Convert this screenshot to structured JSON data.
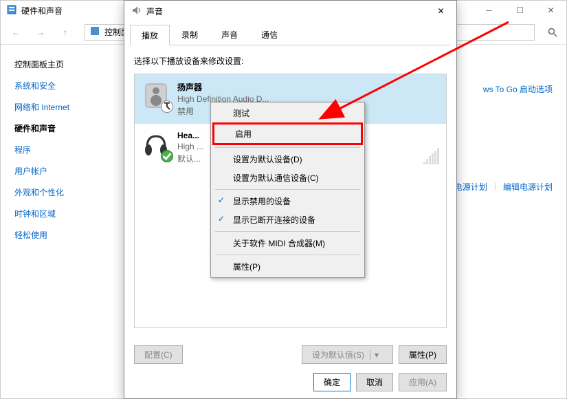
{
  "bgWindow": {
    "title": "硬件和声音",
    "address": "控制面",
    "sidebarHome": "控制面板主页",
    "sidebar": [
      "系统和安全",
      "网络和 Internet",
      "硬件和声音",
      "程序",
      "用户帐户",
      "外观和个性化",
      "时钟和区域",
      "轻松使用"
    ],
    "rightLink1": "ws To Go 启动选项",
    "rightLink2a": "电源计划",
    "rightLink2b": "编辑电源计划"
  },
  "dialog": {
    "title": "声音",
    "tabs": [
      "播放",
      "录制",
      "声音",
      "通信"
    ],
    "instruction": "选择以下播放设备来修改设置:",
    "devices": [
      {
        "name": "扬声器",
        "sub": "High Definition Audio D...",
        "status": "禁用"
      },
      {
        "name": "Hea...",
        "sub": "High ...",
        "status": "默认..."
      }
    ],
    "buttons": {
      "configure": "配置(C)",
      "setDefault": "设为默认值(S)",
      "properties": "属性(P)",
      "ok": "确定",
      "cancel": "取消",
      "apply": "应用(A)"
    }
  },
  "contextMenu": {
    "items": [
      "测试",
      "启用",
      "设置为默认设备(D)",
      "设置为默认通信设备(C)",
      "显示禁用的设备",
      "显示已断开连接的设备",
      "关于软件 MIDI 合成器(M)",
      "属性(P)"
    ]
  }
}
